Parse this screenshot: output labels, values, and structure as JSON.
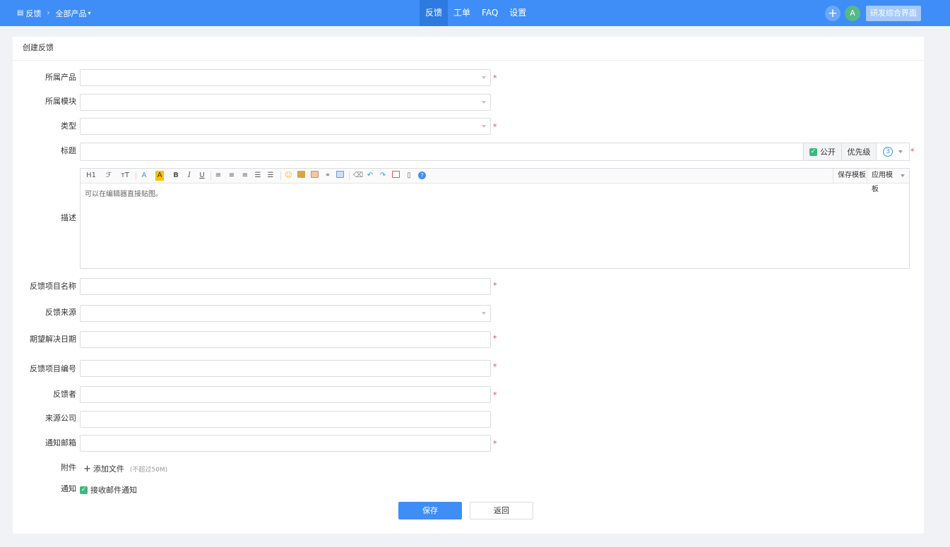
{
  "header": {
    "app_label": "反馈",
    "product_label": "全部产品",
    "nav": [
      {
        "label": "反馈",
        "active": true
      },
      {
        "label": "工单",
        "active": false
      },
      {
        "label": "FAQ",
        "active": false
      },
      {
        "label": "设置",
        "active": false
      }
    ],
    "avatar_initial": "A",
    "workspace_button": "研发综合界面"
  },
  "form": {
    "title": "创建反馈",
    "labels": {
      "product": "所属产品",
      "module": "所属模块",
      "type": "类型",
      "title": "标题",
      "description": "描述",
      "project_name": "反馈项目名称",
      "source": "反馈来源",
      "expected_date": "期望解决日期",
      "project_no": "反馈项目编号",
      "reporter": "反馈者",
      "company": "来源公司",
      "email": "通知邮箱",
      "attachment": "附件",
      "notify": "通知"
    },
    "required_mark": "*",
    "public_label": "公开",
    "priority_label": "优先级",
    "priority_value": "3",
    "editor": {
      "toolbar": [
        "H1",
        "ℱ",
        "ᴛT",
        "A",
        "A",
        "B",
        "I",
        "U"
      ],
      "save_template": "保存模板",
      "apply_template": "应用模板",
      "placeholder": "可以在编辑器直接贴图。"
    },
    "attachment": {
      "add_label": "添加文件",
      "hint": "(不超过50M)"
    },
    "notify_label": "接收邮件通知",
    "save_button": "保存",
    "back_button": "返回"
  },
  "colors": {
    "brand": "#3f8ef7",
    "required": "#e04b4b",
    "check": "#3bb97d"
  }
}
